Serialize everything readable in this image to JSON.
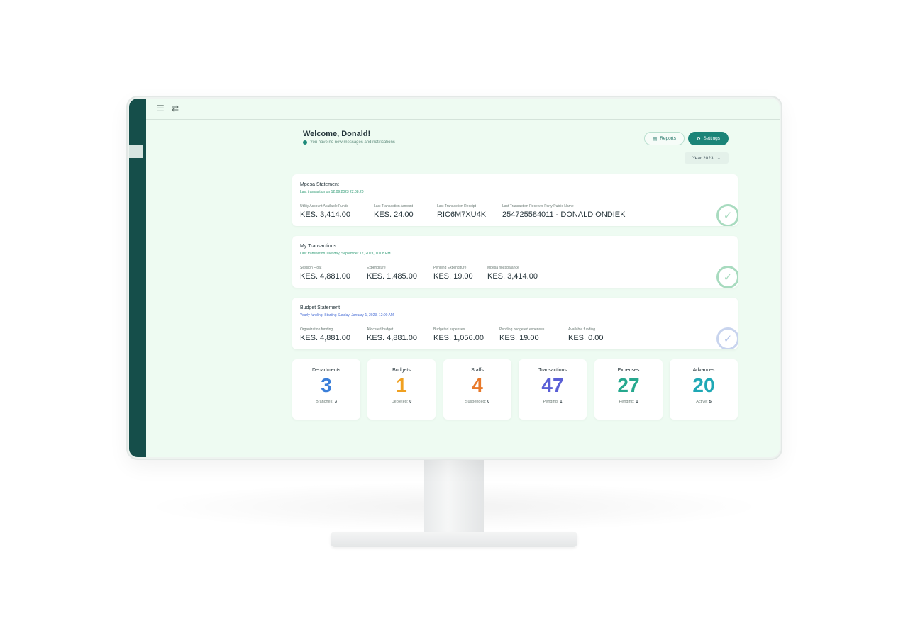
{
  "header": {
    "welcome": "Welcome, Donald!",
    "notice": "You have no new messages and notifications",
    "reports_label": "Reports",
    "settings_label": "Settings",
    "year": "Year 2023"
  },
  "mpesa": {
    "title": "Mpesa Statement",
    "subtitle": "Last transaction on 12.09.2023 22:08:20",
    "stats": [
      {
        "label": "Utility Account Available Funds",
        "value": "KES. 3,414.00"
      },
      {
        "label": "Last Transaction Amount",
        "value": "KES. 24.00"
      },
      {
        "label": "Last Transaction Receipt",
        "value": "RIC6M7XU4K"
      },
      {
        "label": "Last Transaction Receiver Party Public Name",
        "value": "254725584011 - DONALD ONDIEK"
      }
    ]
  },
  "transactions": {
    "title": "My Transactions",
    "subtitle": "Last transaction Tuesday, September 12, 2023, 10:08 PM",
    "stats": [
      {
        "label": "Session Float",
        "value": "KES. 4,881.00"
      },
      {
        "label": "Expenditure",
        "value": "KES. 1,485.00"
      },
      {
        "label": "Pending Expenditure",
        "value": "KES. 19.00"
      },
      {
        "label": "Mpesa float balance",
        "value": "KES. 3,414.00"
      }
    ]
  },
  "budget": {
    "title": "Budget Statement",
    "subtitle": "Yearly funding: Starting Sunday, January 1, 2023, 12:00 AM",
    "stats": [
      {
        "label": "Organization funding",
        "value": "KES. 4,881.00"
      },
      {
        "label": "Allocated budget",
        "value": "KES. 4,881.00"
      },
      {
        "label": "Budgeted expenses",
        "value": "KES. 1,056.00"
      },
      {
        "label": "Pending budgeted expenses",
        "value": "KES. 19.00"
      },
      {
        "label": "Available funding",
        "value": "KES. 0.00"
      }
    ]
  },
  "tiles": [
    {
      "label": "Departments",
      "value": "3",
      "foot_label": "Branches:",
      "foot_value": "3",
      "color": "#3b7fd9"
    },
    {
      "label": "Budgets",
      "value": "1",
      "foot_label": "Depleted:",
      "foot_value": "0",
      "color": "#f0a020"
    },
    {
      "label": "Staffs",
      "value": "4",
      "foot_label": "Suspended:",
      "foot_value": "0",
      "color": "#e8792a"
    },
    {
      "label": "Transactions",
      "value": "47",
      "foot_label": "Pending:",
      "foot_value": "1",
      "color": "#5a5fd6"
    },
    {
      "label": "Expenses",
      "value": "27",
      "foot_label": "Pending:",
      "foot_value": "1",
      "color": "#26a88e"
    },
    {
      "label": "Advances",
      "value": "20",
      "foot_label": "Active:",
      "foot_value": "5",
      "color": "#1fa8b5"
    }
  ]
}
